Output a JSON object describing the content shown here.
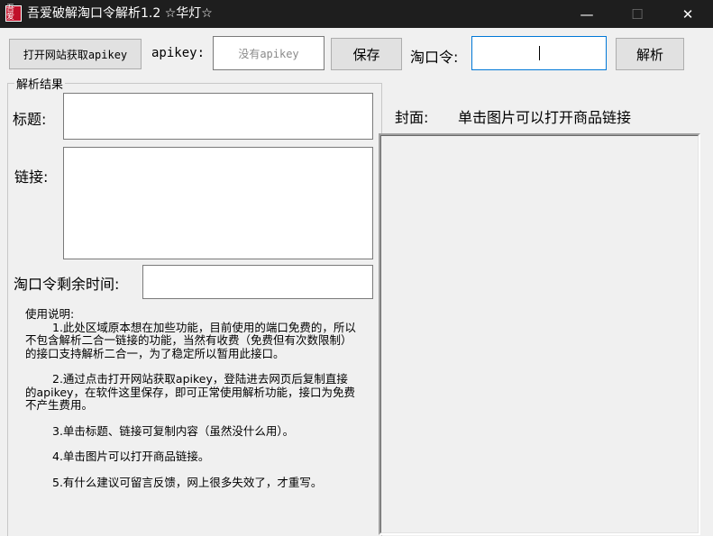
{
  "window": {
    "title": "吾爱破解淘口令解析1.2  ☆华灯☆",
    "icon_glyph": "吾爱",
    "minimize": "—",
    "maximize": "☐",
    "close": "✕"
  },
  "toolbar": {
    "get_apikey_button": "打开网站获取apikey",
    "apikey_label": "apikey:",
    "apikey_value": "没有apikey",
    "save_button": "保存",
    "taokouling_label": "淘口令:",
    "taokouling_value": "",
    "parse_button": "解析"
  },
  "result": {
    "group_caption": "解析结果",
    "title_label": "标题:",
    "title_value": "",
    "link_label": "链接:",
    "link_value": "",
    "remaining_label": "淘口令剩余时间:",
    "remaining_value": "",
    "instructions": {
      "heading": "使用说明:",
      "item1": "1.此处区域原本想在加些功能，目前使用的端口免费的，所以不包含解析二合一链接的功能，当然有收费（免费但有次数限制）的接口支持解析二合一，为了稳定所以暂用此接口。",
      "item2": "2.通过点击打开网站获取apikey，登陆进去网页后复制直接的apikey，在软件这里保存，即可正常使用解析功能，接口为免费不产生费用。",
      "item3": "3.单击标题、链接可复制内容（虽然没什么用）。",
      "item4": "4.单击图片可以打开商品链接。",
      "item5": "5.有什么建议可留言反馈，网上很多失效了，才重写。"
    }
  },
  "cover": {
    "label": "封面:",
    "hint": "单击图片可以打开商品链接"
  }
}
